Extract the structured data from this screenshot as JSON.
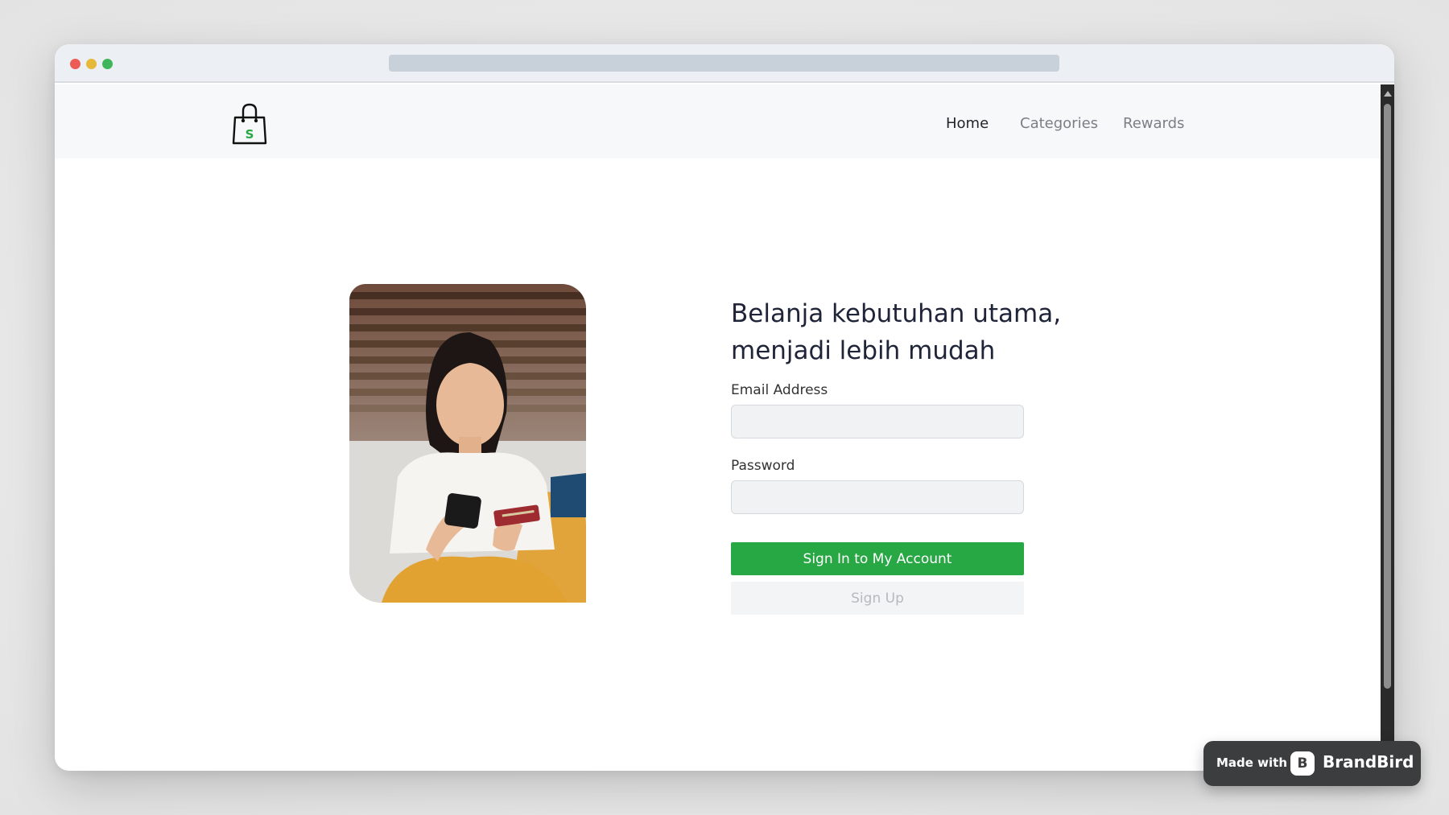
{
  "nav": {
    "logo_letter": "S",
    "links": [
      {
        "label": "Home",
        "active": true
      },
      {
        "label": "Categories",
        "active": false
      },
      {
        "label": "Rewards",
        "active": false
      }
    ]
  },
  "login": {
    "heading_line1": "Belanja kebutuhan utama,",
    "heading_line2": "menjadi lebih mudah",
    "email_label": "Email Address",
    "email_value": "",
    "password_label": "Password",
    "password_value": "",
    "signin_label": "Sign In to My Account",
    "signup_label": "Sign Up"
  },
  "badge": {
    "made_with": "Made with",
    "brand": "BrandBird"
  },
  "colors": {
    "primary_green": "#28a745",
    "heading_text": "#1f2438",
    "nav_active": "#212529",
    "nav_inactive": "#7a7f85"
  }
}
